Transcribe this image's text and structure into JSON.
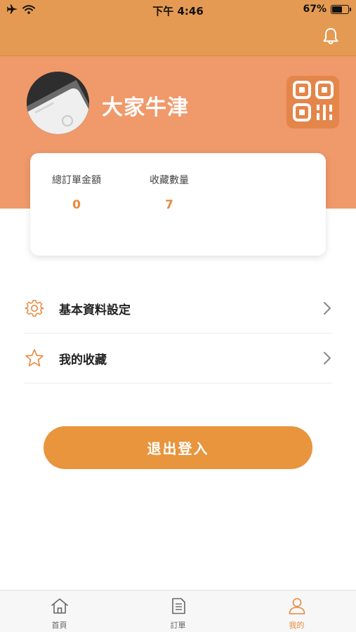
{
  "status_bar": {
    "time": "下午 4:46",
    "battery_text": "67%",
    "battery_level": 0.67,
    "icons": [
      "airplane-icon",
      "wifi-icon",
      "battery-icon"
    ]
  },
  "nav": {
    "icon": "bell-icon"
  },
  "profile": {
    "name": "大家牛津",
    "avatar_icon": "phone-photo-avatar",
    "qr_icon": "qr-code-icon"
  },
  "stats": [
    {
      "label": "總訂單金額",
      "value": "0"
    },
    {
      "label": "收藏數量",
      "value": "7"
    }
  ],
  "menu": [
    {
      "label": "基本資料設定",
      "icon": "gear-icon"
    },
    {
      "label": "我的收藏",
      "icon": "star-icon"
    }
  ],
  "logout": {
    "label": "退出登入"
  },
  "tabs": [
    {
      "label": "首頁",
      "icon": "home-icon",
      "active": false
    },
    {
      "label": "訂單",
      "icon": "document-icon",
      "active": false
    },
    {
      "label": "我的",
      "icon": "person-icon",
      "active": true
    }
  ],
  "colors": {
    "nav_orange": "#e49a52",
    "header_salmon": "#f0996a",
    "accent_orange": "#e8893e",
    "button_orange": "#e8953e"
  }
}
